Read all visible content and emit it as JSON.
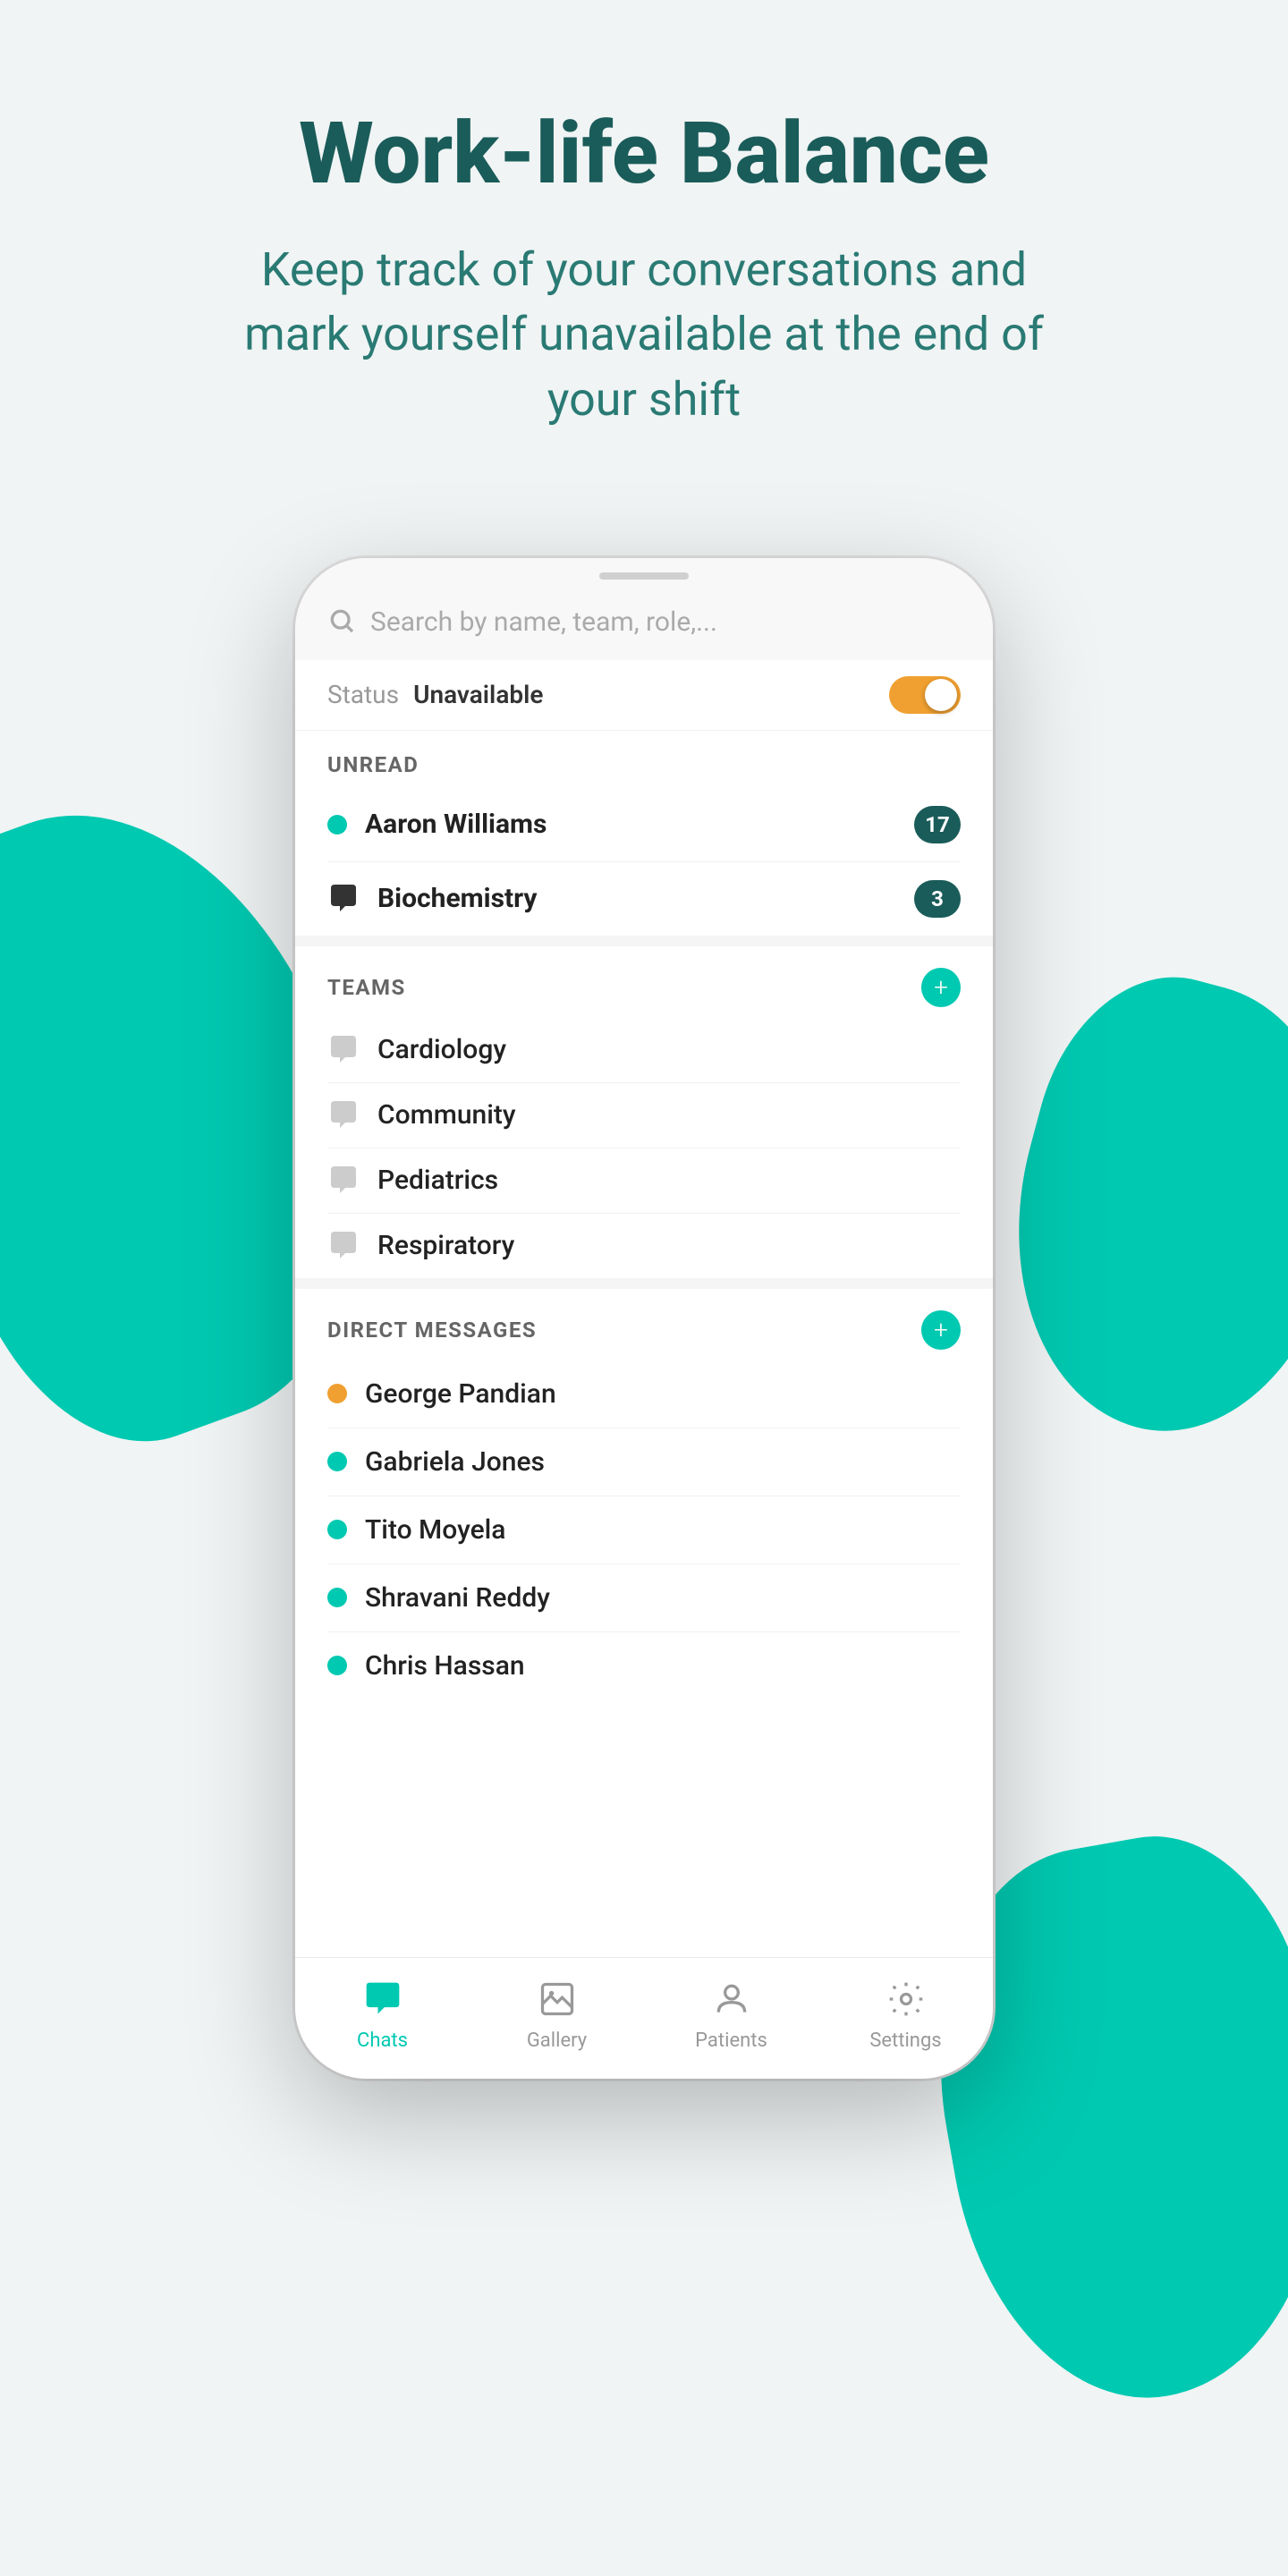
{
  "page": {
    "background": "#f0f4f4",
    "title": "Work-life Balance",
    "subtitle": "Keep track of your conversations and mark yourself unavailable at the end of your shift"
  },
  "search": {
    "placeholder": "Search by name, team, role,..."
  },
  "status": {
    "label": "Status",
    "value": "Unavailable",
    "toggle": true
  },
  "sections": {
    "unread": {
      "title": "UNREAD",
      "items": [
        {
          "name": "Aaron Williams",
          "badge": "17",
          "type": "dot-teal",
          "bold": true
        },
        {
          "name": "Biochemistry",
          "badge": "3",
          "type": "bubble-dark",
          "bold": true
        }
      ]
    },
    "teams": {
      "title": "TEAMS",
      "items": [
        {
          "name": "Cardiology"
        },
        {
          "name": "Community"
        },
        {
          "name": "Pediatrics"
        },
        {
          "name": "Respiratory"
        }
      ]
    },
    "directMessages": {
      "title": "DIRECT MESSAGES",
      "items": [
        {
          "name": "George Pandian",
          "dotColor": "orange"
        },
        {
          "name": "Gabriela Jones",
          "dotColor": "teal"
        },
        {
          "name": "Tito Moyela",
          "dotColor": "teal"
        },
        {
          "name": "Shravani Reddy",
          "dotColor": "teal"
        },
        {
          "name": "Chris Hassan",
          "dotColor": "teal"
        }
      ]
    }
  },
  "bottomNav": {
    "items": [
      {
        "label": "Chats",
        "active": true,
        "icon": "chat-icon"
      },
      {
        "label": "Gallery",
        "active": false,
        "icon": "gallery-icon"
      },
      {
        "label": "Patients",
        "active": false,
        "icon": "patients-icon"
      },
      {
        "label": "Settings",
        "active": false,
        "icon": "settings-icon"
      }
    ]
  }
}
